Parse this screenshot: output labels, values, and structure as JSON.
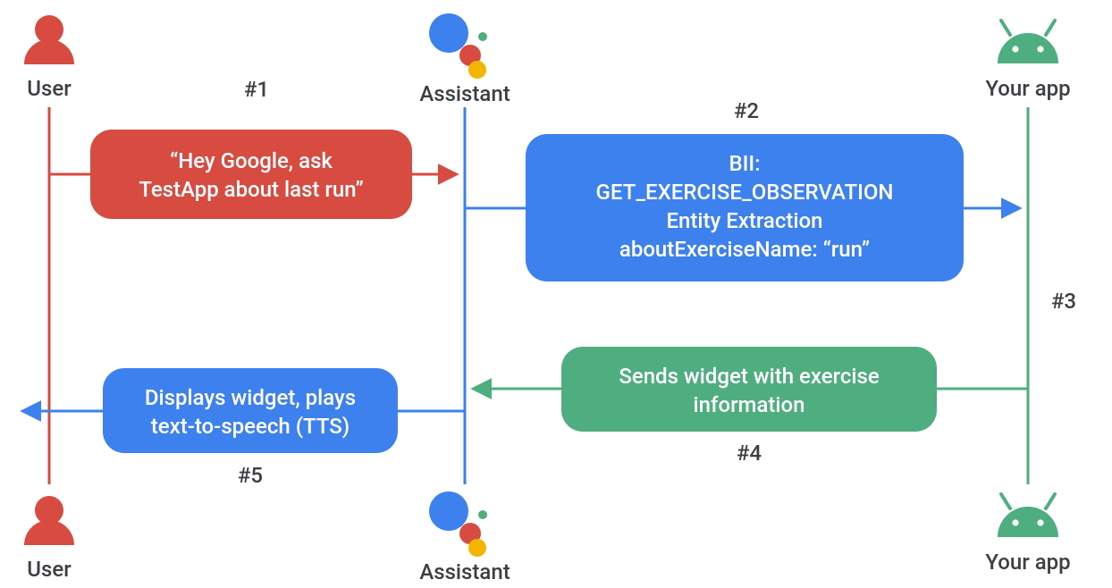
{
  "colors": {
    "red": "#d84b40",
    "blue": "#3C81EE",
    "green": "#4EAE80",
    "yellow": "#F2B600",
    "text": "#3c4043"
  },
  "entities": {
    "user_top": {
      "label": "User"
    },
    "user_bottom": {
      "label": "User"
    },
    "assistant_top": {
      "label": "Assistant"
    },
    "assistant_bottom": {
      "label": "Assistant"
    },
    "app_top": {
      "label": "Your app"
    },
    "app_bottom": {
      "label": "Your app"
    }
  },
  "steps": {
    "s1": {
      "label": "#1",
      "lines": [
        "“Hey Google, ask",
        "TestApp about last run”"
      ]
    },
    "s2": {
      "label": "#2",
      "lines": [
        "BII:",
        "GET_EXERCISE_OBSERVATION",
        "Entity Extraction",
        "aboutExerciseName: “run”"
      ]
    },
    "s3": {
      "label": "#3"
    },
    "s4": {
      "label": "#4",
      "lines": [
        "Sends widget with exercise",
        "information"
      ]
    },
    "s5": {
      "label": "#5",
      "lines": [
        "Displays widget, plays",
        "text-to-speech (TTS)"
      ]
    }
  }
}
